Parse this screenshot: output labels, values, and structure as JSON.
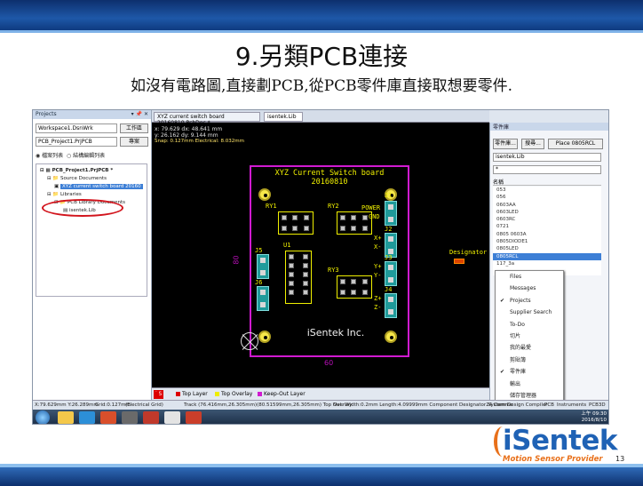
{
  "slide": {
    "title": "9.另類PCB連接",
    "subtitle": "如沒有電路圖,直接劃PCB,從PCB零件庫直接取想要零件.",
    "page_number": "13"
  },
  "logo": {
    "text": "iSentek",
    "tagline": "Motion Sensor Provider"
  },
  "projects_panel": {
    "header": "Projects",
    "workspace": "Workspace1.DsnWrk",
    "workspace_btn": "工作區",
    "project": "PCB_Project1.PrjPCB",
    "project_btn": "專案",
    "radio_file": "檔案列表",
    "radio_struct": "結構編輯列表",
    "tree": [
      {
        "label": "PCB_Project1.PrjPCB *",
        "level": 0
      },
      {
        "label": "Source Documents",
        "level": 1
      },
      {
        "label": "XYZ current switch board 20160",
        "level": 2,
        "selected": true
      },
      {
        "label": "Libraries",
        "level": 1
      },
      {
        "label": "PCB Library Documents",
        "level": 2
      },
      {
        "label": "isentek.Lib",
        "level": 3
      }
    ]
  },
  "editor": {
    "tab_doc": "XYZ current switch board 20160810.PcbDoc *",
    "tab_lib": "isentek.Lib",
    "coords": {
      "line1": "x: 79.629  dx: 48.641 mm",
      "line2": "y: 26.162  dy: 9.144  mm",
      "snap": "Snap: 0.127mm Electrical: 8.032mm"
    },
    "board_title_1": "XYZ Current Switch board",
    "board_title_2": "20160810",
    "board_brand": "iSentek Inc.",
    "labels": {
      "ry1": "RY1",
      "ry2": "RY2",
      "ry3": "RY3",
      "u1": "U1",
      "j1": "J1",
      "j2": "J2",
      "j3": "J3",
      "j4": "J4",
      "j5": "J5",
      "j6": "J6",
      "power": "POWER",
      "gnd": "GND",
      "xp": "X+",
      "xm": "X-",
      "yp": "Y+",
      "ym": "Y-",
      "zp": "Z+",
      "zm": "Z-"
    },
    "dim_width": "60",
    "dim_height": "80",
    "designator": "Designator",
    "layers": {
      "ls": "LS",
      "top": "Top Layer",
      "overlay": "Top Overlay",
      "keepout": "Keep-Out Layer"
    }
  },
  "library_panel": {
    "header": "零件庫",
    "btn_lib": "零件庫...",
    "btn_search": "搜尋...",
    "btn_place": "Place 0805RCL",
    "lib_select": "isentek.Lib",
    "filter": "*",
    "col_name": "名稱",
    "items": [
      "053",
      "056",
      "0603AA",
      "0603LED",
      "0603RC",
      "0721",
      "0805 0603A",
      "0805DIODE1",
      "0805LED",
      "0805RCL",
      "117_3a"
    ],
    "selected": "0805RCL"
  },
  "context_menu": {
    "items": [
      {
        "label": "Files",
        "checked": false
      },
      {
        "label": "Messages",
        "checked": false
      },
      {
        "label": "Projects",
        "checked": true
      },
      {
        "label": "Supplier Search",
        "checked": false
      },
      {
        "label": "To-Do",
        "checked": false
      },
      {
        "label": "切片",
        "checked": false
      },
      {
        "label": "我的最愛",
        "checked": false
      },
      {
        "label": "剪貼簿",
        "checked": false
      },
      {
        "label": "零件庫",
        "checked": true
      },
      {
        "label": "輸出",
        "checked": false
      },
      {
        "label": "儲存管理器",
        "checked": false
      }
    ]
  },
  "status": {
    "coords": "X:79.629mm Y:26.289mm",
    "grid": "Grid:0.127mm",
    "electrical": "(Electrical Grid)",
    "track": "Track (76.416mm,26.305mm)(80.51599mm,26.305mm)  Top Overlay",
    "net": "Net: Width:0.2mm Length:4.09999mm  Component Designator24 Comme",
    "system": "System",
    "design_compiler": "Design Compiler",
    "pcb": "PCB",
    "instruments": "Instruments",
    "pcb3d": "PCB3D"
  },
  "taskbar": {
    "time": "上午 09:30",
    "date": "2016/8/10"
  }
}
